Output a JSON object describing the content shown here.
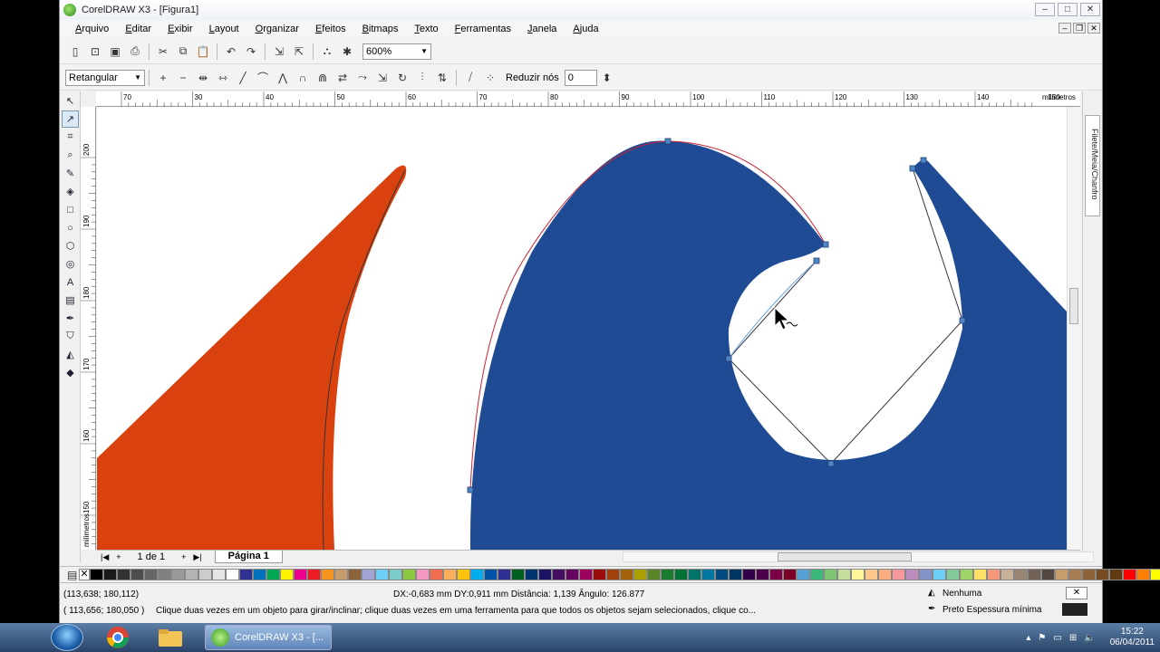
{
  "window": {
    "title": "CorelDRAW X3 - [Figura1]"
  },
  "menu": [
    "Arquivo",
    "Editar",
    "Exibir",
    "Layout",
    "Organizar",
    "Efeitos",
    "Bitmaps",
    "Texto",
    "Ferramentas",
    "Janela",
    "Ajuda"
  ],
  "toolbar": {
    "zoom": "600%"
  },
  "propbar": {
    "selection_mode": "Retangular",
    "reduce_nodes_label": "Reduzir nós",
    "reduce_nodes_value": "0"
  },
  "ruler": {
    "units_label": "milímetros",
    "h_ticks": [
      "70",
      "30",
      "40",
      "50",
      "60",
      "70",
      "80",
      "90",
      "100",
      "110",
      "120",
      "130",
      "140",
      "150"
    ],
    "v_ticks": [
      "200",
      "190",
      "180",
      "170",
      "160",
      "150"
    ],
    "v_units_label": "milímetros"
  },
  "docker": {
    "tab_label": "Filete/Meia/Chanfro"
  },
  "pages": {
    "counter": "1 de 1",
    "tab": "Página 1"
  },
  "status": {
    "cursor_pos": "(113,638; 180,112)",
    "object_pos": "( 113,656; 180,050 )",
    "measure": "DX:-0,683 mm DY:0,911 mm Distância: 1,139 Ângulo: 126.877",
    "hint": "Clique duas vezes em um objeto para girar/inclinar; clique duas vezes em uma ferramenta para que todos os objetos sejam selecionados, clique co...",
    "fill": "Nenhuma",
    "outline": "Preto  Espessura mínima"
  },
  "taskbar": {
    "active_app": "CorelDRAW X3 - [...",
    "time": "15:22",
    "date": "06/04/2011"
  },
  "colors": {
    "orange_shape": "#d9420f",
    "blue_shape": "#1f4a94",
    "node": "#4f86c6"
  },
  "palette_colors": [
    "#000000",
    "#1a1a1a",
    "#333333",
    "#4d4d4d",
    "#666666",
    "#808080",
    "#999999",
    "#b3b3b3",
    "#cccccc",
    "#e6e6e6",
    "#ffffff",
    "#2e3192",
    "#0072bc",
    "#00a651",
    "#fff200",
    "#ec008c",
    "#ed1c24",
    "#f7941d",
    "#c69c6d",
    "#8c6239",
    "#a3a3d6",
    "#6dcff6",
    "#7accc8",
    "#8dc63f",
    "#f49ac1",
    "#f26c4f",
    "#fbaf5d",
    "#ffc20e",
    "#00aeef",
    "#0054a6",
    "#2e3192",
    "#005e20",
    "#003471",
    "#1b1464",
    "#440e62",
    "#630460",
    "#9e005d",
    "#9e0b0f",
    "#a0410d",
    "#a36209",
    "#aba000",
    "#598527",
    "#1a7b30",
    "#007236",
    "#00746b",
    "#0076a3",
    "#004a80",
    "#003663",
    "#32004b",
    "#4b0049",
    "#7b0046",
    "#7a0026",
    "#56a0d3",
    "#3cb878",
    "#7dc473",
    "#c4df9b",
    "#fff799",
    "#fdc68a",
    "#f9ad81",
    "#f6989d",
    "#bd8cbf",
    "#8393ca",
    "#6ecff6",
    "#82ca9c",
    "#a0d468",
    "#ffe066",
    "#f7977a",
    "#c7b299",
    "#998675",
    "#736357",
    "#534741",
    "#c69c6d",
    "#a67c52",
    "#8c6239",
    "#754c24",
    "#603913",
    "#ff0000",
    "#ff8000",
    "#ffff00",
    "#80ff00",
    "#00ff00",
    "#00ff80"
  ]
}
